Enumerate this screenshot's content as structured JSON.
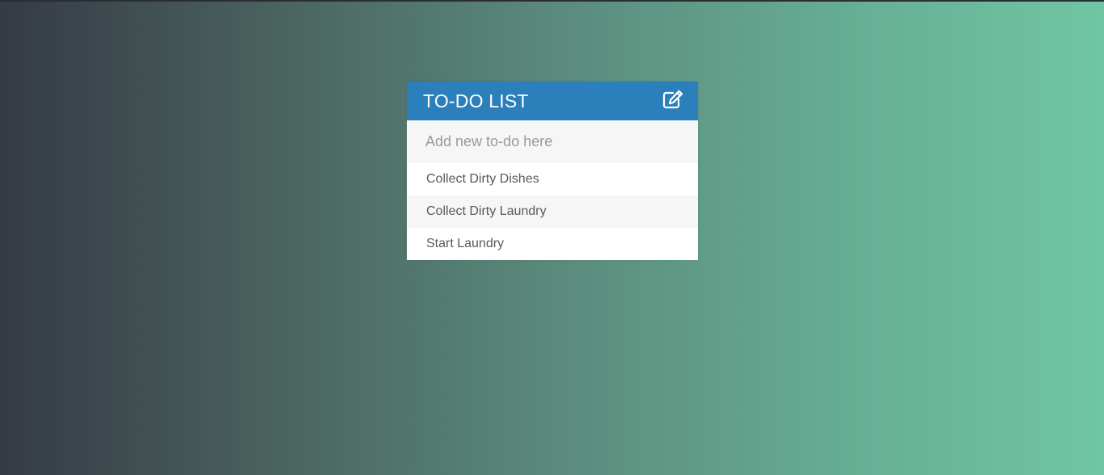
{
  "colors": {
    "header_background": "#2b7fbb",
    "gradient_start": "#353a44",
    "gradient_end": "#6fc6a4"
  },
  "header": {
    "title": "TO-DO LIST",
    "icon": "pencil-square-edit-icon"
  },
  "input": {
    "placeholder": "Add new to-do here",
    "value": ""
  },
  "todos": [
    {
      "label": "Collect Dirty Dishes"
    },
    {
      "label": "Collect Dirty Laundry"
    },
    {
      "label": "Start Laundry"
    }
  ]
}
